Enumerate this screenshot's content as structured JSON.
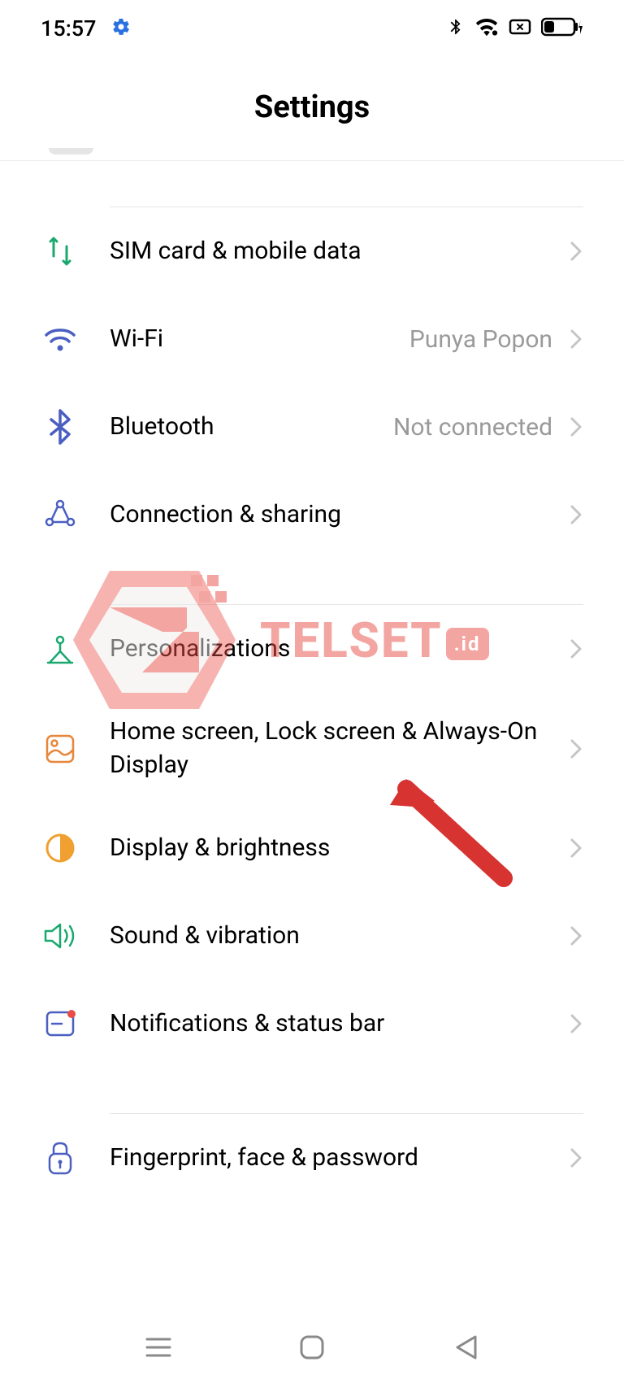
{
  "status": {
    "time": "15:57",
    "gear_icon": "gear",
    "bluetooth_icon": "bluetooth",
    "wifi_icon": "wifi",
    "screen_icon": "screen-box",
    "battery_icon": "battery-charging"
  },
  "header": {
    "title": "Settings"
  },
  "rows": {
    "sim": {
      "label": "SIM card & mobile data",
      "icon": "sim-data-icon",
      "color": "#1aa86f"
    },
    "wifi": {
      "label": "Wi-Fi",
      "value": "Punya Popon",
      "icon": "wifi-icon",
      "color": "#4a5fc1"
    },
    "bluetooth": {
      "label": "Bluetooth",
      "value": "Not connected",
      "icon": "bluetooth-icon",
      "color": "#4a5fc1"
    },
    "connection": {
      "label": "Connection & sharing",
      "icon": "connection-icon",
      "color": "#4a5fc1"
    },
    "personalizations": {
      "label": "Personalizations",
      "icon": "personalizations-icon",
      "color": "#1aa86f"
    },
    "homescreen": {
      "label": "Home screen, Lock screen & Always-On Display",
      "icon": "homescreen-icon",
      "color": "#e8863a"
    },
    "display": {
      "label": "Display & brightness",
      "icon": "display-icon",
      "color": "#f0a030"
    },
    "sound": {
      "label": "Sound & vibration",
      "icon": "sound-icon",
      "color": "#1aa86f"
    },
    "notifications": {
      "label": "Notifications & status bar",
      "icon": "notifications-icon",
      "color": "#4a5fc1"
    },
    "fingerprint": {
      "label": "Fingerprint, face & password",
      "icon": "fingerprint-icon",
      "color": "#4a5fc1"
    }
  },
  "watermark": {
    "text": "TELSET",
    "badge": ".id"
  }
}
